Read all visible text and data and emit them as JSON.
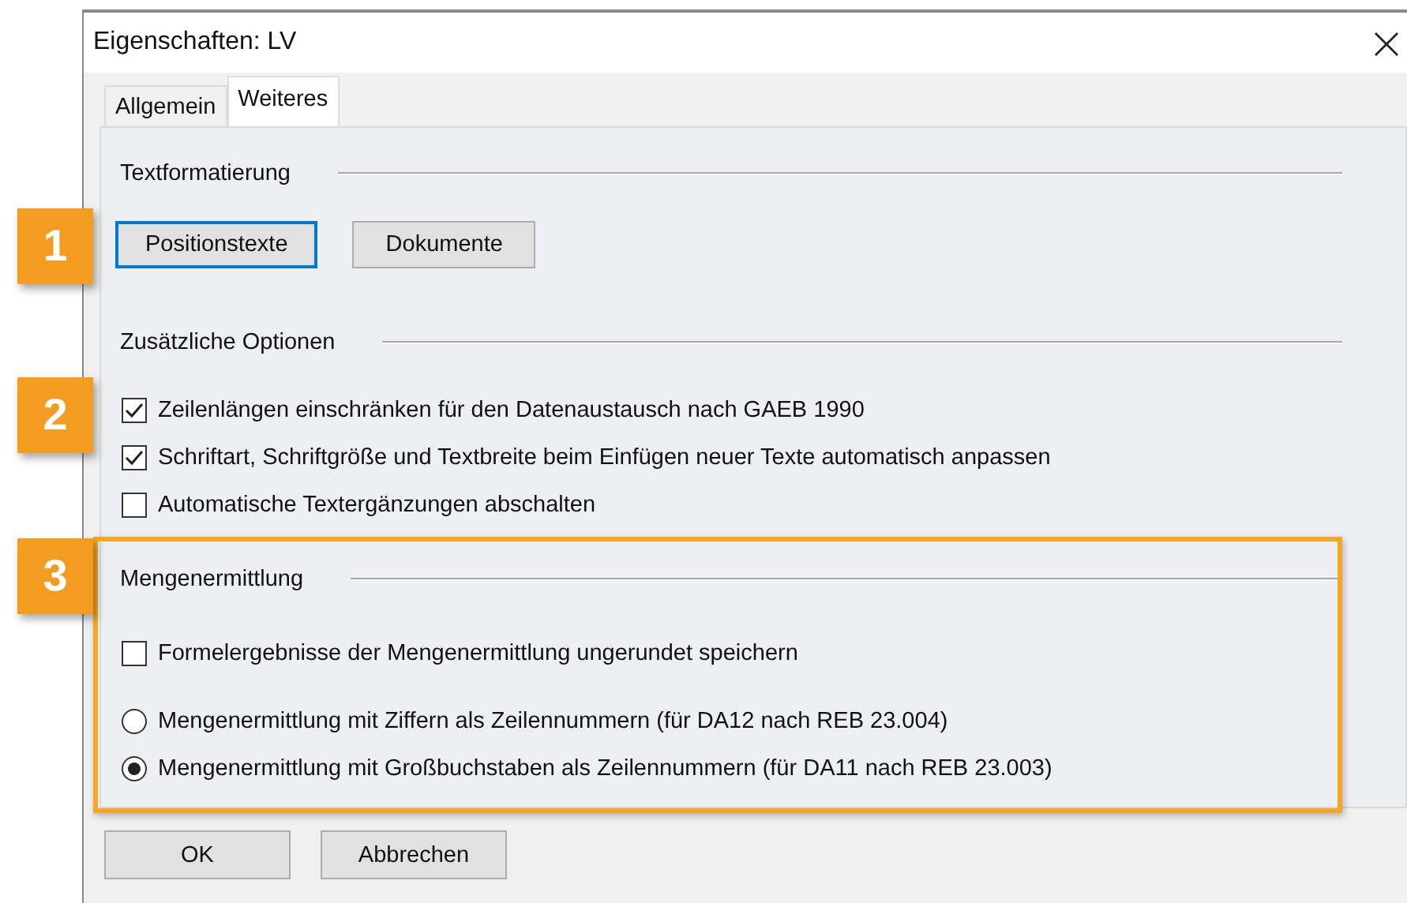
{
  "window": {
    "title": "Eigenschaften: LV"
  },
  "tabs": [
    {
      "label": "Allgemein",
      "selected": false
    },
    {
      "label": "Weiteres",
      "selected": true
    }
  ],
  "sections": [
    {
      "title": "Textformatierung",
      "callout": "1",
      "highlighted": false,
      "buttons": [
        {
          "label": "Positionstexte",
          "focused": true
        },
        {
          "label": "Dokumente",
          "focused": false
        }
      ]
    },
    {
      "title": "Zusätzliche Optionen",
      "callout": "2",
      "highlighted": false,
      "options": [
        {
          "kind": "checkbox",
          "label": "Zeilenlängen einschränken für den Datenaustausch nach GAEB 1990",
          "checked": true
        },
        {
          "kind": "checkbox",
          "label": "Schriftart, Schriftgröße und Textbreite beim Einfügen neuer Texte automatisch anpassen",
          "checked": true
        },
        {
          "kind": "checkbox",
          "label": "Automatische Textergänzungen abschalten",
          "checked": false
        }
      ]
    },
    {
      "title": "Mengenermittlung",
      "callout": "3",
      "highlighted": true,
      "options": [
        {
          "kind": "checkbox",
          "label": "Formelergebnisse der Mengenermittlung ungerundet speichern",
          "checked": false
        },
        {
          "kind": "radio",
          "label": "Mengenermittlung mit Ziffern als Zeilennummern (für DA12 nach REB 23.004)",
          "selected": false
        },
        {
          "kind": "radio",
          "label": "Mengenermittlung mit Großbuchstaben als Zeilennummern (für DA11 nach REB 23.003)",
          "selected": true
        }
      ]
    }
  ],
  "buttons": [
    "OK",
    "Abbrechen"
  ]
}
